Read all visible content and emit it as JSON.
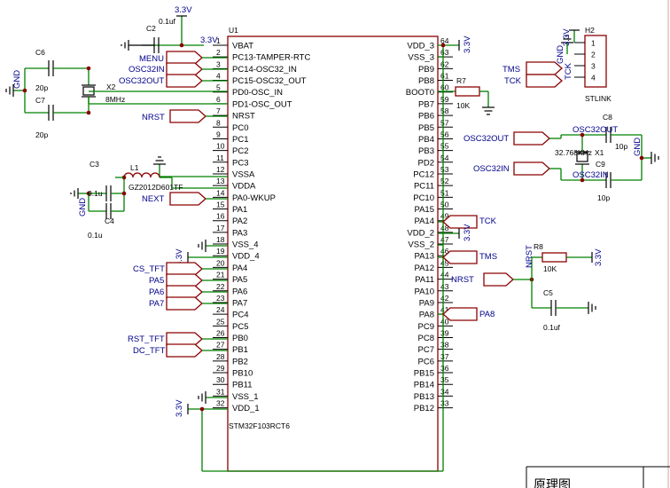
{
  "colors": {
    "wire": "#008000",
    "body": "#8b0000",
    "label": "#00008b",
    "text": "#000000",
    "grid": "#d8a0a0",
    "junction": "#8b0000"
  },
  "mcu": {
    "designator": "U1",
    "part": "STM32F103RCT6",
    "left_pins": [
      {
        "num": "1",
        "name": "VBAT"
      },
      {
        "num": "2",
        "name": "PC13-TAMPER-RTC"
      },
      {
        "num": "3",
        "name": "PC14-OSC32_IN"
      },
      {
        "num": "4",
        "name": "PC15-OSC32_OUT"
      },
      {
        "num": "5",
        "name": "PD0-OSC_IN"
      },
      {
        "num": "6",
        "name": "PD1-OSC_OUT"
      },
      {
        "num": "7",
        "name": "NRST"
      },
      {
        "num": "8",
        "name": "PC0"
      },
      {
        "num": "9",
        "name": "PC1"
      },
      {
        "num": "10",
        "name": "PC2"
      },
      {
        "num": "11",
        "name": "PC3"
      },
      {
        "num": "12",
        "name": "VSSA"
      },
      {
        "num": "13",
        "name": "VDDA"
      },
      {
        "num": "14",
        "name": "PA0-WKUP"
      },
      {
        "num": "15",
        "name": "PA1"
      },
      {
        "num": "16",
        "name": "PA2"
      },
      {
        "num": "17",
        "name": "PA3"
      },
      {
        "num": "18",
        "name": "VSS_4"
      },
      {
        "num": "19",
        "name": "VDD_4"
      },
      {
        "num": "20",
        "name": "PA4"
      },
      {
        "num": "21",
        "name": "PA5"
      },
      {
        "num": "22",
        "name": "PA6"
      },
      {
        "num": "23",
        "name": "PA7"
      },
      {
        "num": "24",
        "name": "PC4"
      },
      {
        "num": "25",
        "name": "PC5"
      },
      {
        "num": "26",
        "name": "PB0"
      },
      {
        "num": "27",
        "name": "PB1"
      },
      {
        "num": "28",
        "name": "PB2"
      },
      {
        "num": "29",
        "name": "PB10"
      },
      {
        "num": "30",
        "name": "PB11"
      },
      {
        "num": "31",
        "name": "VSS_1"
      },
      {
        "num": "32",
        "name": "VDD_1"
      }
    ],
    "right_pins": [
      {
        "num": "64",
        "name": "VDD_3"
      },
      {
        "num": "63",
        "name": "VSS_3"
      },
      {
        "num": "62",
        "name": "PB9"
      },
      {
        "num": "61",
        "name": "PB8"
      },
      {
        "num": "60",
        "name": "BOOT0"
      },
      {
        "num": "59",
        "name": "PB7"
      },
      {
        "num": "58",
        "name": "PB6"
      },
      {
        "num": "57",
        "name": "PB5"
      },
      {
        "num": "56",
        "name": "PB4"
      },
      {
        "num": "55",
        "name": "PB3"
      },
      {
        "num": "54",
        "name": "PD2"
      },
      {
        "num": "53",
        "name": "PC12"
      },
      {
        "num": "52",
        "name": "PC11"
      },
      {
        "num": "51",
        "name": "PC10"
      },
      {
        "num": "50",
        "name": "PA15"
      },
      {
        "num": "49",
        "name": "PA14"
      },
      {
        "num": "48",
        "name": "VDD_2"
      },
      {
        "num": "47",
        "name": "VSS_2"
      },
      {
        "num": "46",
        "name": "PA13"
      },
      {
        "num": "45",
        "name": "PA12"
      },
      {
        "num": "44",
        "name": "PA11"
      },
      {
        "num": "43",
        "name": "PA10"
      },
      {
        "num": "42",
        "name": "PA9"
      },
      {
        "num": "41",
        "name": "PA8"
      },
      {
        "num": "40",
        "name": "PC9"
      },
      {
        "num": "39",
        "name": "PC8"
      },
      {
        "num": "38",
        "name": "PC7"
      },
      {
        "num": "37",
        "name": "PC6"
      },
      {
        "num": "36",
        "name": "PB15"
      },
      {
        "num": "35",
        "name": "PB14"
      },
      {
        "num": "34",
        "name": "PB13"
      },
      {
        "num": "33",
        "name": "PB12"
      }
    ]
  },
  "left_nets": {
    "menu": "MENU",
    "osc32in": "OSC32IN",
    "osc32out": "OSC32OUT",
    "nrst": "NRST",
    "next": "NEXT",
    "cs_tft": "CS_TFT",
    "pa5": "PA5",
    "pa6": "PA6",
    "pa7": "PA7",
    "rst_tft": "RST_TFT",
    "dc_tft": "DC_TFT"
  },
  "right_nets": {
    "tck": "TCK",
    "tms": "TMS",
    "pa8": "PA8",
    "nrst": "NRST",
    "osc32out": "OSC32OUT",
    "osc32in": "OSC32IN"
  },
  "power": {
    "v33": "3.3V",
    "gnd": "GND"
  },
  "components": {
    "c2": {
      "ref": "C2",
      "value": "0.1uf"
    },
    "c6": {
      "ref": "C6",
      "value": "20p"
    },
    "c7": {
      "ref": "C7",
      "value": "20p"
    },
    "x2": {
      "ref": "X2",
      "value": "8MHz"
    },
    "c3": {
      "ref": "C3",
      "value": "0.1u"
    },
    "c4": {
      "ref": "C4",
      "value": "0.1u"
    },
    "l1": {
      "ref": "L1",
      "value": "GZ2012D601TF"
    },
    "r7": {
      "ref": "R7",
      "value": "10K"
    },
    "r8": {
      "ref": "R8",
      "value": "10K"
    },
    "c5": {
      "ref": "C5",
      "value": "0.1uf"
    },
    "c8": {
      "ref": "C8",
      "value": "10p"
    },
    "c9": {
      "ref": "C9",
      "value": "10p"
    },
    "x1": {
      "ref": "X1",
      "value": "32.768KHz"
    },
    "h2": {
      "ref": "H2",
      "value": "STLINK",
      "pins": [
        "1",
        "2",
        "3",
        "4"
      ]
    }
  },
  "stlink_nets": {
    "tms": "TMS",
    "tck": "TCK",
    "v33": "3.3V",
    "gnd": "GND"
  },
  "title_block": {
    "text": "原理图"
  }
}
